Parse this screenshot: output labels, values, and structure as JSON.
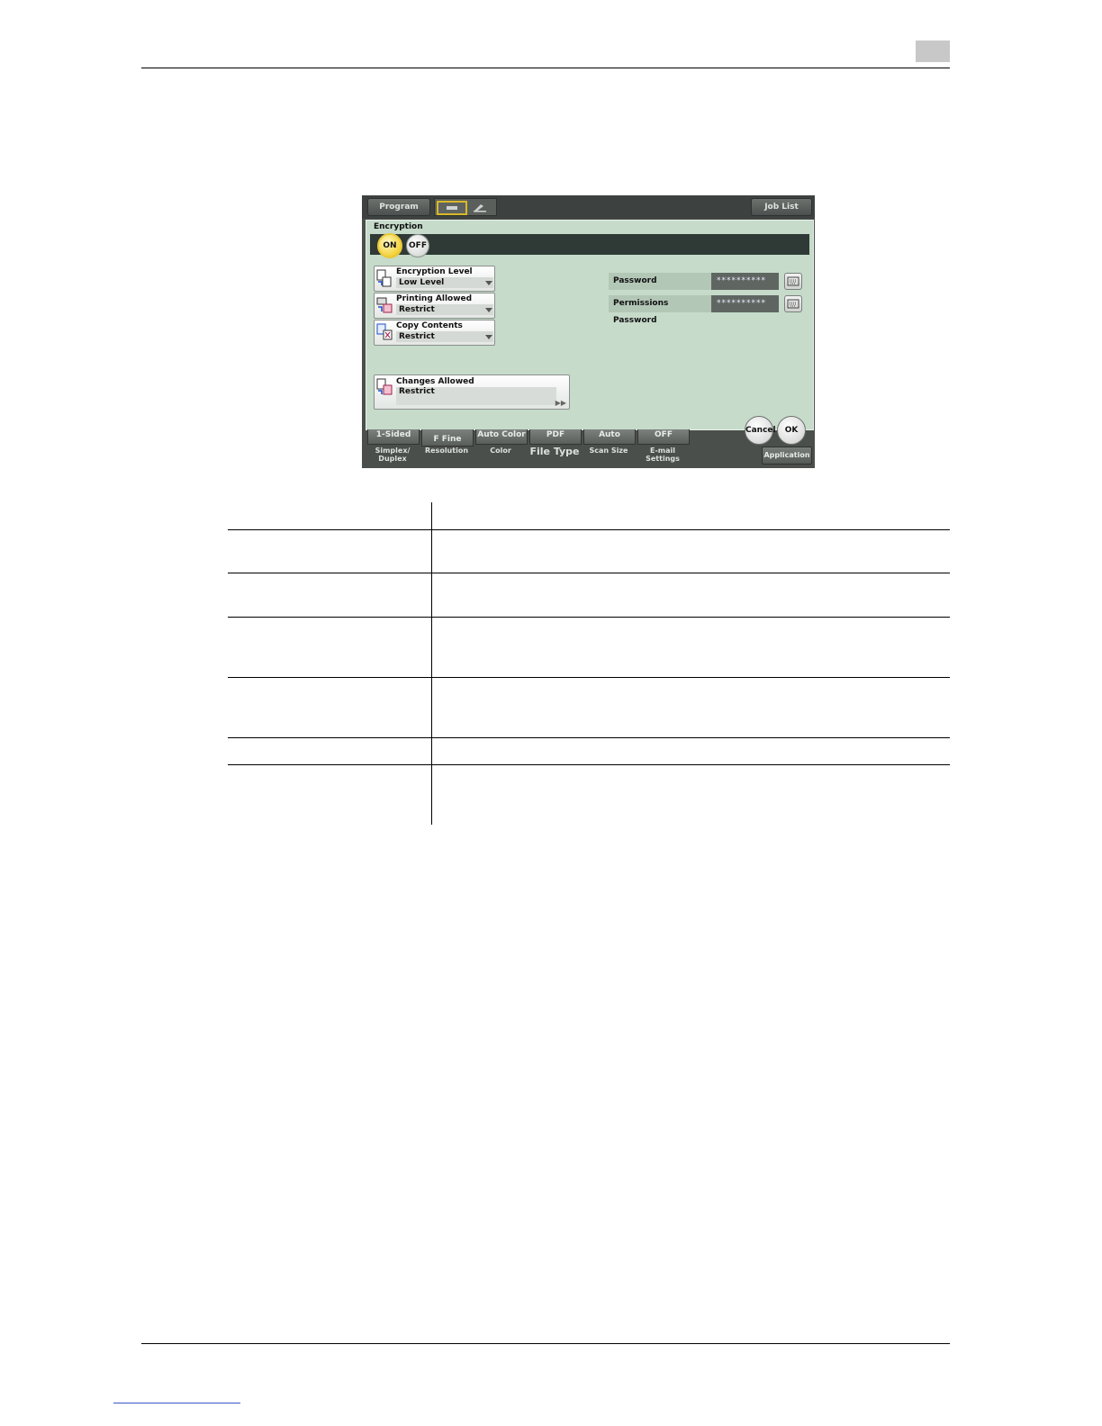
{
  "device": {
    "topbar": {
      "program": "Program",
      "job_list": "Job List"
    },
    "panel_title": "Encryption",
    "toggle": {
      "on": "ON",
      "off": "OFF"
    },
    "settings": [
      {
        "label": "Encryption Level",
        "value": "Low Level"
      },
      {
        "label": "Printing Allowed",
        "value": "Restrict"
      },
      {
        "label": "Copy Contents",
        "value": "Restrict"
      }
    ],
    "changes_allowed": {
      "label": "Changes Allowed",
      "value": "Restrict"
    },
    "password": {
      "label": "Password",
      "value": "**********"
    },
    "permissions_password": {
      "label": "Permissions Password",
      "value": "**********"
    },
    "actions": {
      "cancel": "Cancel",
      "ok": "OK"
    },
    "bottom_tabs": [
      {
        "value": "1-Sided",
        "label": "Simplex/\nDuplex"
      },
      {
        "value": "F Fine",
        "label": "Resolution"
      },
      {
        "value": "Auto Color",
        "label": "Color"
      },
      {
        "value": "PDF",
        "label": "File Type"
      },
      {
        "value": "Auto",
        "label": "Scan Size"
      },
      {
        "value": "OFF",
        "label": "E-mail\nSettings"
      }
    ],
    "application": "Application"
  },
  "colors": {
    "panel": "#c6dbca",
    "frame": "#4b4f4c",
    "on_button": "#f4d23a"
  }
}
